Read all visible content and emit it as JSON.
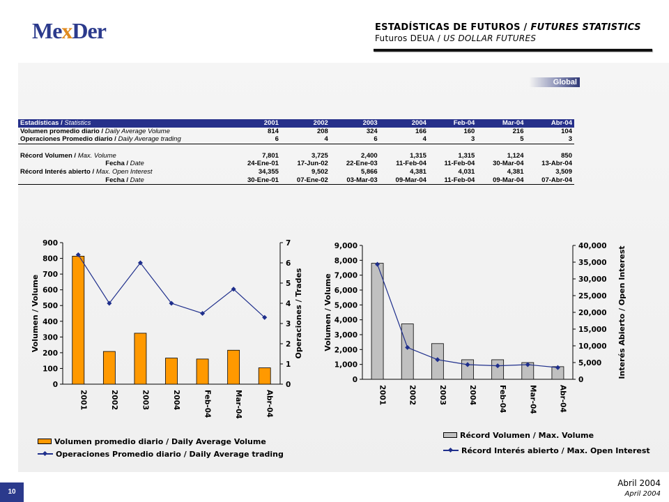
{
  "header": {
    "logo": {
      "pre": "Me",
      "mid": "x",
      "post": "Der"
    },
    "title_es": "ESTADÍSTICAS DE FUTUROS /",
    "title_en": "FUTURES STATISTICS",
    "sub_es": "Futuros DEUA /",
    "sub_en": "US DOLLAR FUTURES"
  },
  "badge": "Global",
  "table": {
    "head": {
      "es": "Estadísticas /",
      "en": "Statistics",
      "cols": [
        "2001",
        "2002",
        "2003",
        "2004",
        "Feb-04",
        "Mar-04",
        "Abr-04"
      ]
    },
    "rows": [
      {
        "es": "Volumen promedio diario /",
        "en": "Daily Average Volume",
        "values": [
          "814",
          "208",
          "324",
          "166",
          "160",
          "216",
          "104"
        ]
      },
      {
        "es": "Operaciones Promedio diario /",
        "en": "Daily Average trading",
        "values": [
          "6",
          "4",
          "6",
          "4",
          "3",
          "5",
          "3"
        ]
      },
      {
        "es": "Récord Volumen /",
        "en": "Max. Volume",
        "values": [
          "7,801",
          "3,725",
          "2,400",
          "1,315",
          "1,315",
          "1,124",
          "850"
        ]
      },
      {
        "es": "Fecha /",
        "en": "Date",
        "values": [
          "24-Ene-01",
          "17-Jun-02",
          "22-Ene-03",
          "11-Feb-04",
          "11-Feb-04",
          "30-Mar-04",
          "13-Abr-04"
        ]
      },
      {
        "es": "Récord Interés abierto /",
        "en": "Max. Open Interest",
        "values": [
          "34,355",
          "9,502",
          "5,866",
          "4,381",
          "4,031",
          "4,381",
          "3,509"
        ]
      },
      {
        "es": "Fecha /",
        "en": "Date",
        "values": [
          "30-Ene-01",
          "07-Ene-02",
          "03-Mar-03",
          "09-Mar-04",
          "11-Feb-04",
          "09-Mar-04",
          "07-Abr-04"
        ]
      }
    ]
  },
  "chart_data": [
    {
      "type": "bar",
      "categories": [
        "2001",
        "2002",
        "2003",
        "2004",
        "Feb-04",
        "Mar-04",
        "Abr-04"
      ],
      "series": [
        {
          "name": "Volumen promedio diario / Daily Average Volume",
          "kind": "bar",
          "axis": "left",
          "color": "#ff9900",
          "values": [
            814,
            208,
            324,
            166,
            160,
            216,
            104
          ]
        },
        {
          "name": "Operaciones Promedio diario / Daily Average trading",
          "kind": "line",
          "axis": "right",
          "color": "#1f2f8c",
          "values": [
            6.4,
            4.0,
            6.0,
            4.0,
            3.5,
            4.7,
            3.3
          ]
        }
      ],
      "ylabel": "Volumen / Volume",
      "y2label": "Operaciones / Trades",
      "ylim": [
        0,
        900
      ],
      "yticks": [
        "0",
        "100",
        "200",
        "300",
        "400",
        "500",
        "600",
        "700",
        "800",
        "900"
      ],
      "y2lim": [
        0,
        7
      ],
      "y2ticks": [
        "0",
        "1",
        "2",
        "3",
        "4",
        "5",
        "6",
        "7"
      ],
      "legend": "bottom"
    },
    {
      "type": "bar",
      "categories": [
        "2001",
        "2002",
        "2003",
        "2004",
        "Feb-04",
        "Mar-04",
        "Abr-04"
      ],
      "series": [
        {
          "name": "Récord Volumen / Max. Volume",
          "kind": "bar",
          "axis": "left",
          "color": "#c0c0c0",
          "values": [
            7801,
            3725,
            2400,
            1315,
            1315,
            1124,
            850
          ]
        },
        {
          "name": "Récord Interés abierto / Max. Open Interest",
          "kind": "line",
          "axis": "right",
          "color": "#1f2f8c",
          "values": [
            34355,
            9502,
            5866,
            4381,
            4031,
            4381,
            3509
          ]
        }
      ],
      "ylabel": "Volumen / Volume",
      "y2label": "Interés Abierto / Open Interest",
      "ylim": [
        0,
        9000
      ],
      "yticks": [
        "0",
        "1,000",
        "2,000",
        "3,000",
        "4,000",
        "5,000",
        "6,000",
        "7,000",
        "8,000",
        "9,000"
      ],
      "y2lim": [
        0,
        40000
      ],
      "y2ticks": [
        "0",
        "5,000",
        "10,000",
        "15,000",
        "20,000",
        "25,000",
        "30,000",
        "35,000",
        "40,000"
      ],
      "legend": "bottom"
    }
  ],
  "footer": {
    "page": "10",
    "date_es": "Abril 2004",
    "date_en": "April 2004"
  }
}
